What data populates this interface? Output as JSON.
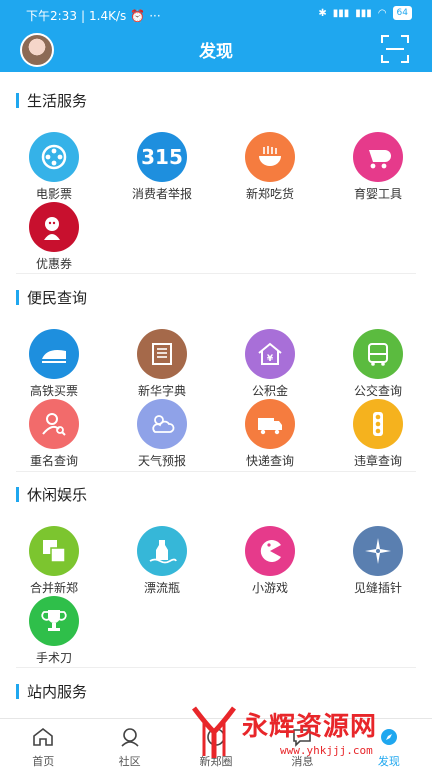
{
  "status_bar": {
    "time": "下午2:33",
    "network_speed": "1.4K/s",
    "battery": "64"
  },
  "header": {
    "title": "发现"
  },
  "sections": {
    "life": {
      "title": "生活服务",
      "items": [
        {
          "label": "电影票",
          "icon": "film-reel-icon",
          "color": "#35b2e8"
        },
        {
          "label": "消费者举报",
          "icon": "315-icon",
          "color": "#1e8fde",
          "text": "315"
        },
        {
          "label": "新郑吃货",
          "icon": "noodle-bowl-icon",
          "color": "#f57c3f"
        },
        {
          "label": "育婴工具",
          "icon": "baby-stroller-icon",
          "color": "#e63a8b"
        },
        {
          "label": "优惠券",
          "icon": "kfc-logo-icon",
          "color": "#c8102e"
        }
      ]
    },
    "query": {
      "title": "便民查询",
      "items": [
        {
          "label": "高铁买票",
          "icon": "train-icon",
          "color": "#1e8fde"
        },
        {
          "label": "新华字典",
          "icon": "dictionary-icon",
          "color": "#a5694a"
        },
        {
          "label": "公积金",
          "icon": "house-fund-icon",
          "color": "#a86fd8"
        },
        {
          "label": "公交查询",
          "icon": "bus-icon",
          "color": "#5bbb3f"
        },
        {
          "label": "重名查询",
          "icon": "person-search-icon",
          "color": "#f26b6b"
        },
        {
          "label": "天气预报",
          "icon": "weather-icon",
          "color": "#8fa2e8"
        },
        {
          "label": "快递查询",
          "icon": "delivery-truck-icon",
          "color": "#f57c3f"
        },
        {
          "label": "违章查询",
          "icon": "traffic-light-icon",
          "color": "#f5b21e"
        }
      ]
    },
    "fun": {
      "title": "休闲娱乐",
      "items": [
        {
          "label": "合并新郑",
          "icon": "merge-squares-icon",
          "color": "#7cc52f"
        },
        {
          "label": "漂流瓶",
          "icon": "drift-bottle-icon",
          "color": "#36b7d8"
        },
        {
          "label": "小游戏",
          "icon": "pacman-icon",
          "color": "#e63a8b"
        },
        {
          "label": "见缝插针",
          "icon": "compass-icon",
          "color": "#5a7fb0"
        },
        {
          "label": "手术刀",
          "icon": "trophy-icon",
          "color": "#2fbf4a"
        }
      ]
    },
    "site": {
      "title": "站内服务"
    }
  },
  "tabbar": {
    "items": [
      {
        "label": "首页",
        "icon": "home-icon"
      },
      {
        "label": "社区",
        "icon": "community-icon"
      },
      {
        "label": "新郑圈",
        "icon": "circle-icon"
      },
      {
        "label": "消息",
        "icon": "message-icon"
      },
      {
        "label": "发现",
        "icon": "discover-icon"
      }
    ]
  },
  "watermark": {
    "main": "永辉资源网",
    "sub": "www.yhkjjj.com"
  }
}
